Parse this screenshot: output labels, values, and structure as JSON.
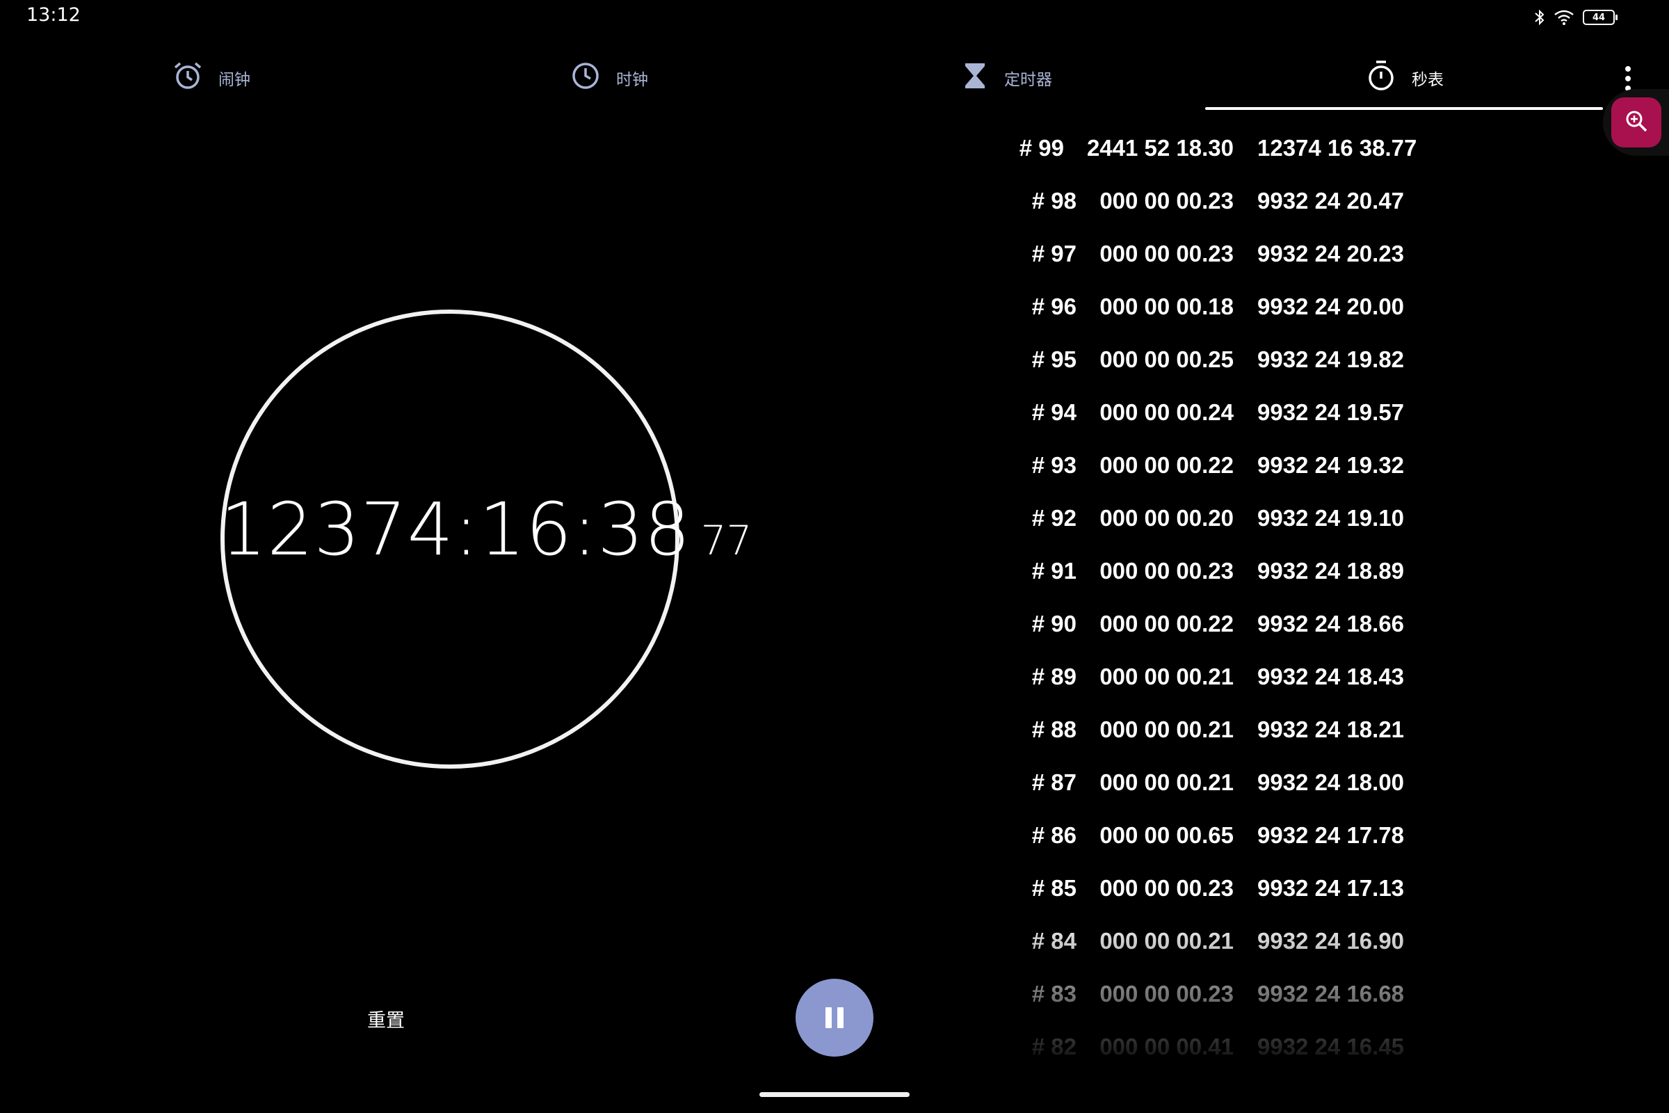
{
  "status_bar": {
    "time": "13:12",
    "battery_level": "44"
  },
  "tabs": [
    {
      "label": "闹钟",
      "icon": "alarm-icon"
    },
    {
      "label": "时钟",
      "icon": "clock-icon"
    },
    {
      "label": "定时器",
      "icon": "hourglass-icon"
    },
    {
      "label": "秒表",
      "icon": "stopwatch-icon",
      "active": true
    }
  ],
  "stopwatch": {
    "time": "12374:16:38",
    "hundredths": "77"
  },
  "controls": {
    "reset_label": "重置"
  },
  "laps": [
    {
      "number": "# 99",
      "lap": "2441 52 18.30",
      "total": "12374 16 38.77"
    },
    {
      "number": "# 98",
      "lap": "000 00 00.23",
      "total": "9932 24 20.47"
    },
    {
      "number": "# 97",
      "lap": "000 00 00.23",
      "total": "9932 24 20.23"
    },
    {
      "number": "# 96",
      "lap": "000 00 00.18",
      "total": "9932 24 20.00"
    },
    {
      "number": "# 95",
      "lap": "000 00 00.25",
      "total": "9932 24 19.82"
    },
    {
      "number": "# 94",
      "lap": "000 00 00.24",
      "total": "9932 24 19.57"
    },
    {
      "number": "# 93",
      "lap": "000 00 00.22",
      "total": "9932 24 19.32"
    },
    {
      "number": "# 92",
      "lap": "000 00 00.20",
      "total": "9932 24 19.10"
    },
    {
      "number": "# 91",
      "lap": "000 00 00.23",
      "total": "9932 24 18.89"
    },
    {
      "number": "# 90",
      "lap": "000 00 00.22",
      "total": "9932 24 18.66"
    },
    {
      "number": "# 89",
      "lap": "000 00 00.21",
      "total": "9932 24 18.43"
    },
    {
      "number": "# 88",
      "lap": "000 00 00.21",
      "total": "9932 24 18.21"
    },
    {
      "number": "# 87",
      "lap": "000 00 00.21",
      "total": "9932 24 18.00"
    },
    {
      "number": "# 86",
      "lap": "000 00 00.65",
      "total": "9932 24 17.78"
    },
    {
      "number": "# 85",
      "lap": "000 00 00.23",
      "total": "9932 24 17.13"
    },
    {
      "number": "# 84",
      "lap": "000 00 00.21",
      "total": "9932 24 16.90"
    },
    {
      "number": "# 83",
      "lap": "000 00 00.23",
      "total": "9932 24 16.68"
    },
    {
      "number": "# 82",
      "lap": "000 00 00.41",
      "total": "9932 24 16.45"
    }
  ],
  "colors": {
    "accent": "#8b97cf",
    "magnifier": "#a8114e",
    "inactive_tab": "#aab5d6"
  }
}
